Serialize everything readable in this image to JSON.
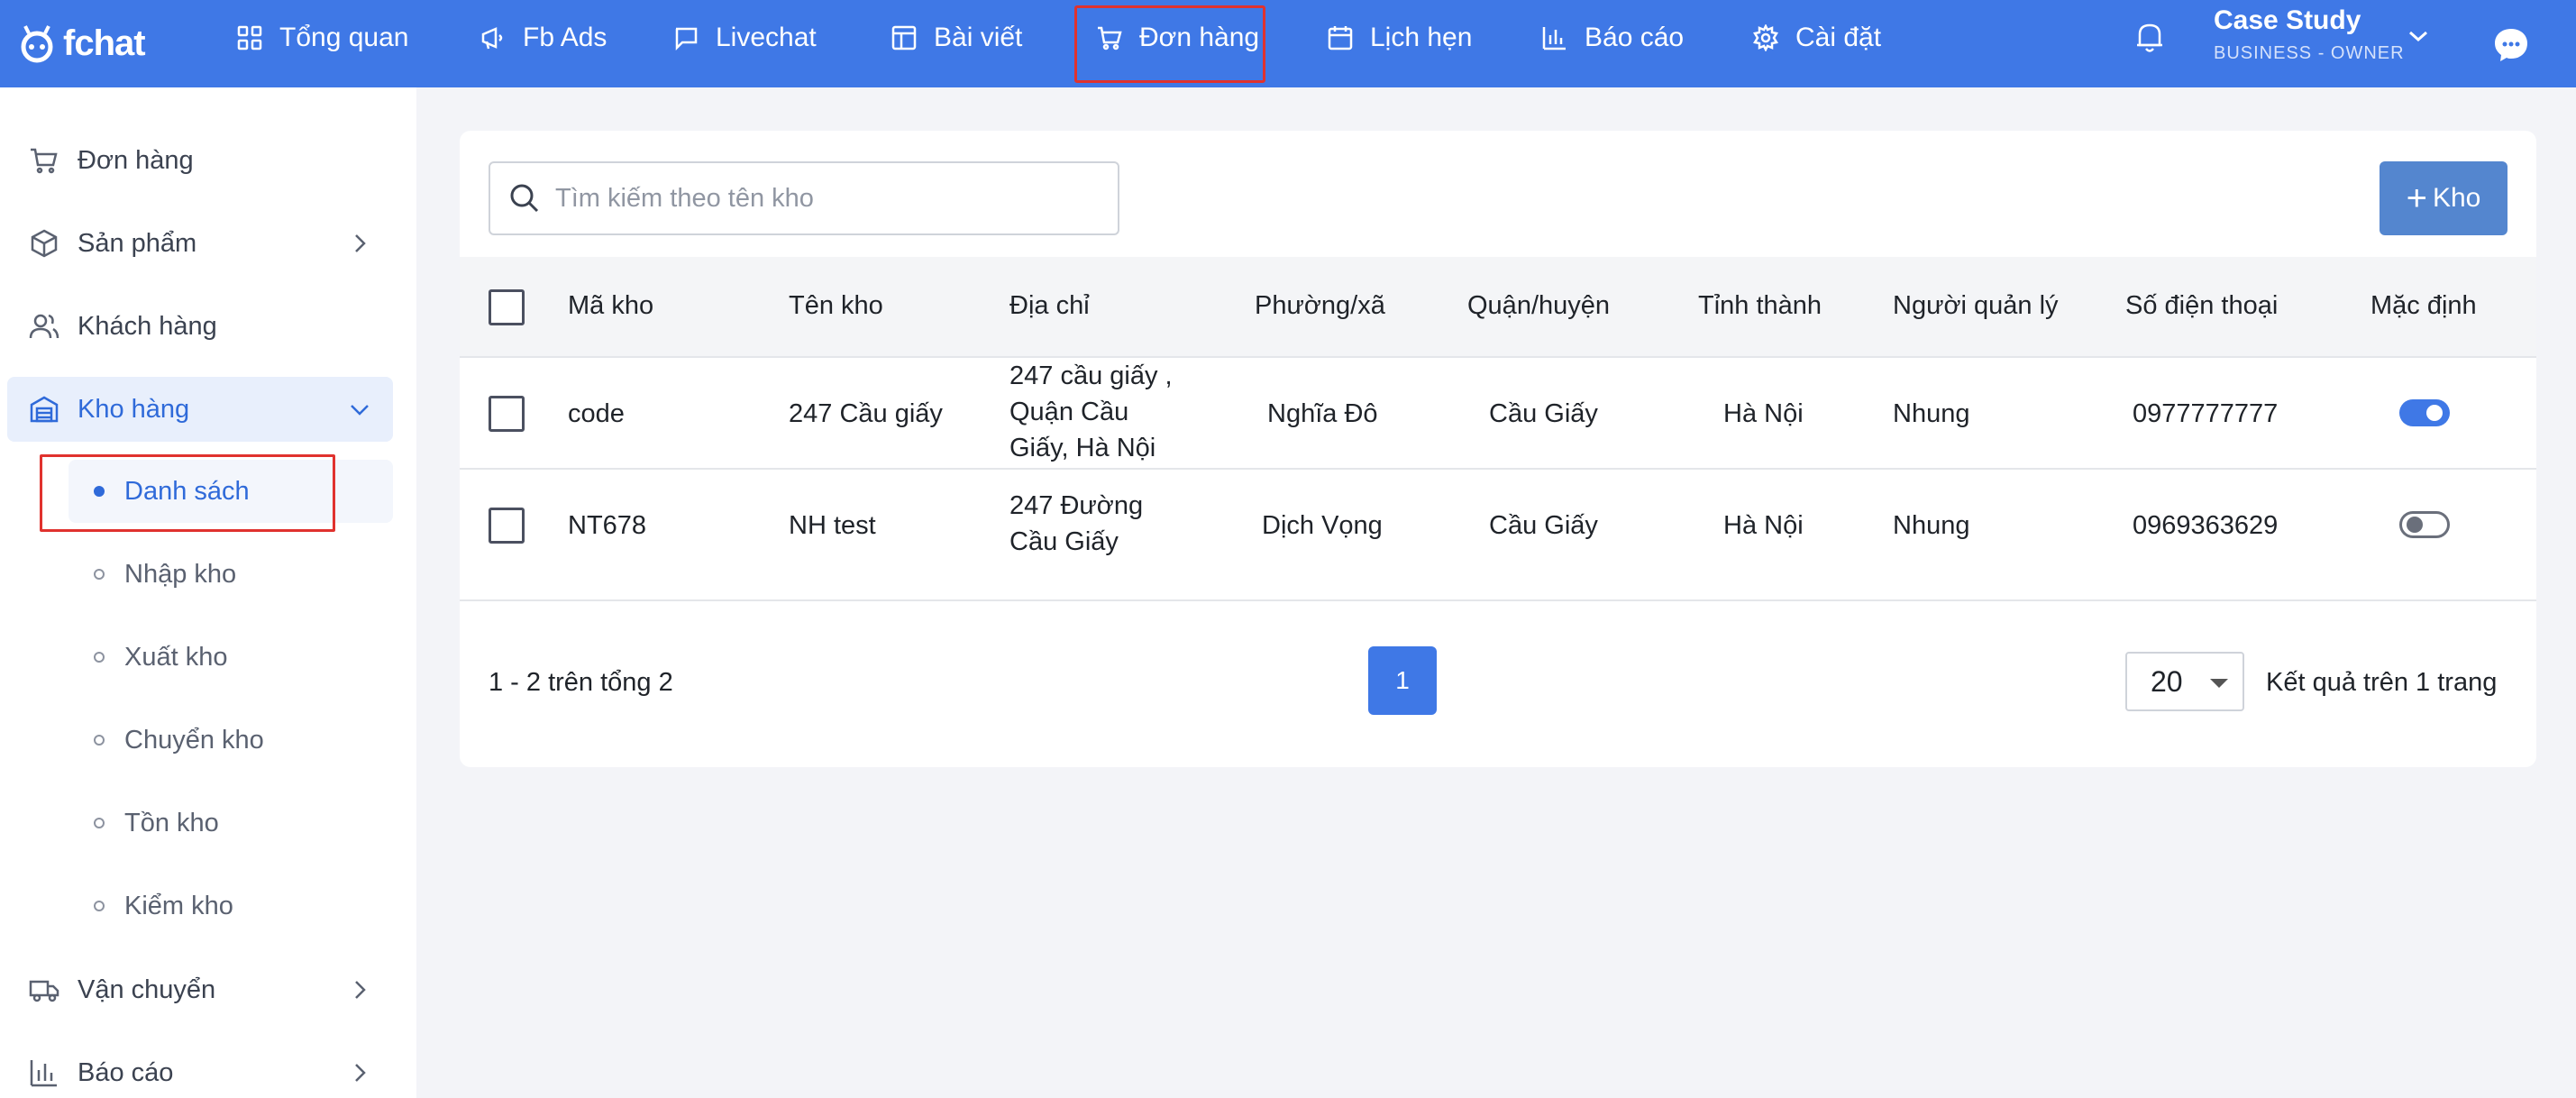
{
  "app": {
    "logo_text": "fchat"
  },
  "nav": {
    "items": [
      {
        "label": "Tổng quan",
        "icon": "grid-icon"
      },
      {
        "label": "Fb Ads",
        "icon": "megaphone-icon"
      },
      {
        "label": "Livechat",
        "icon": "chat-icon"
      },
      {
        "label": "Bài viết",
        "icon": "layout-icon"
      },
      {
        "label": "Đơn hàng",
        "icon": "cart-icon",
        "highlighted": true
      },
      {
        "label": "Lịch hẹn",
        "icon": "calendar-icon"
      },
      {
        "label": "Báo cáo",
        "icon": "bar-chart-icon"
      },
      {
        "label": "Cài đặt",
        "icon": "gear-icon"
      }
    ]
  },
  "user": {
    "name": "Case Study",
    "role": "BUSINESS - OWNER"
  },
  "sidebar": {
    "items": [
      {
        "label": "Đơn hàng",
        "icon": "cart-icon"
      },
      {
        "label": "Sản phẩm",
        "icon": "box-icon",
        "expandable": true
      },
      {
        "label": "Khách hàng",
        "icon": "users-icon"
      },
      {
        "label": "Kho hàng",
        "icon": "warehouse-icon",
        "expanded": true,
        "active": true
      },
      {
        "label": "Vận chuyển",
        "icon": "truck-icon",
        "expandable": true
      },
      {
        "label": "Báo cáo",
        "icon": "bar-chart-icon",
        "expandable": true
      }
    ],
    "sub_items": [
      {
        "label": "Danh sách",
        "active": true
      },
      {
        "label": "Nhập kho"
      },
      {
        "label": "Xuất kho"
      },
      {
        "label": "Chuyển kho"
      },
      {
        "label": "Tồn kho"
      },
      {
        "label": "Kiểm kho"
      }
    ]
  },
  "toolbar": {
    "search_placeholder": "Tìm kiếm theo tên kho",
    "add_button_label": "Kho"
  },
  "table": {
    "headers": [
      "Mã kho",
      "Tên kho",
      "Địa chỉ",
      "Phường/xã",
      "Quận/huyện",
      "Tỉnh thành",
      "Người quản lý",
      "Số điện thoại",
      "Mặc định"
    ],
    "rows": [
      {
        "code": "code",
        "name": "247 Cầu giấy",
        "address_lines": [
          "247 cầu giấy ,",
          "Quận Cầu",
          "Giấy, Hà Nội"
        ],
        "ward": "Nghĩa Đô",
        "district": "Cầu Giấy",
        "province": "Hà Nội",
        "manager": "Nhung",
        "phone": "0977777777",
        "is_default": true
      },
      {
        "code": "NT678",
        "name": "NH test",
        "address_lines": [
          "247 Đường",
          "Cầu Giấy"
        ],
        "ward": "Dịch Vọng",
        "district": "Cầu Giấy",
        "province": "Hà Nội",
        "manager": "Nhung",
        "phone": "0969363629",
        "is_default": false
      }
    ]
  },
  "pagination": {
    "summary": "1 - 2 trên tổng 2",
    "current_page": "1",
    "page_size": "20",
    "page_size_label": "Kết quả trên 1 trang"
  },
  "colors": {
    "brand": "#3f78e6",
    "highlight_border": "#e0322e",
    "active_text": "#2f6ad9"
  }
}
